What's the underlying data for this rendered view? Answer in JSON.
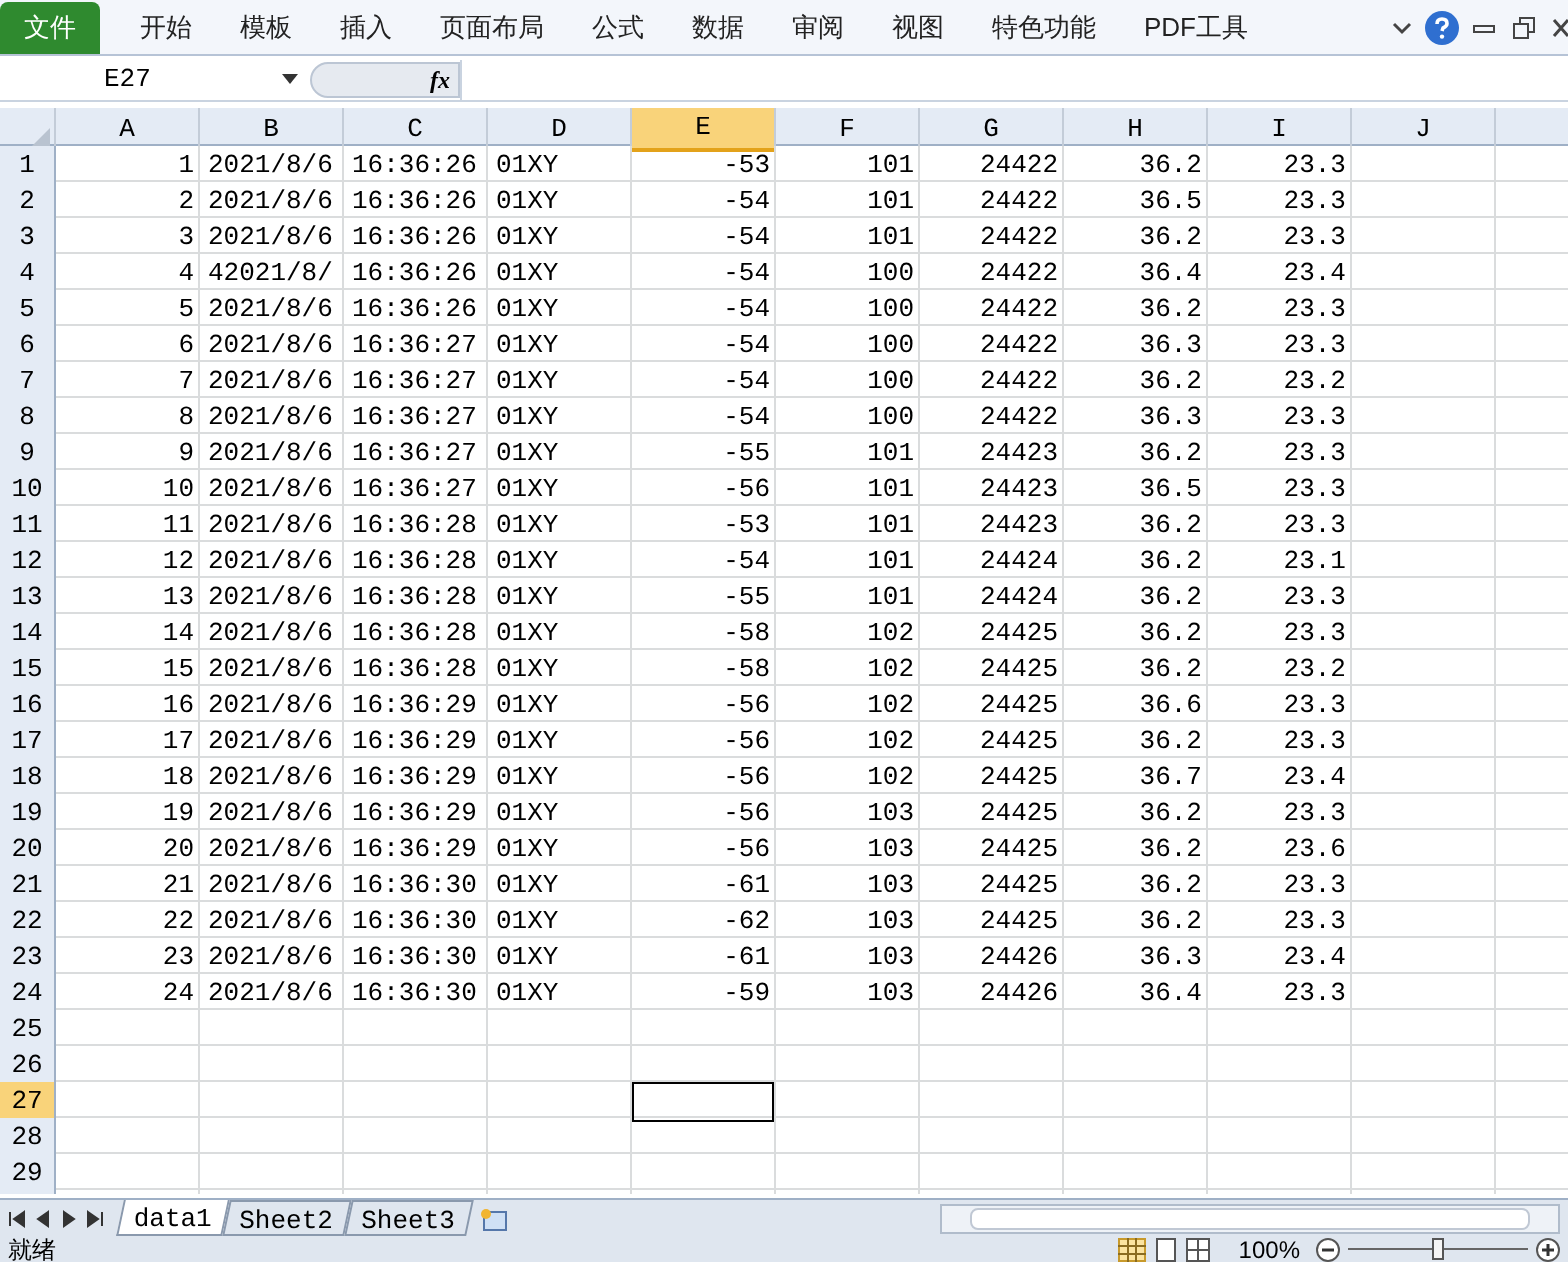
{
  "ribbon_tabs": [
    {
      "label": "文件",
      "kind": "file",
      "selected": false
    },
    {
      "label": "开始",
      "kind": "tab",
      "selected": false
    },
    {
      "label": "模板",
      "kind": "tab",
      "selected": false
    },
    {
      "label": "插入",
      "kind": "tab",
      "selected": false
    },
    {
      "label": "页面布局",
      "kind": "tab",
      "selected": false
    },
    {
      "label": "公式",
      "kind": "tab",
      "selected": false
    },
    {
      "label": "数据",
      "kind": "tab",
      "selected": false
    },
    {
      "label": "审阅",
      "kind": "tab",
      "selected": false
    },
    {
      "label": "视图",
      "kind": "tab",
      "selected": false
    },
    {
      "label": "特色功能",
      "kind": "tab",
      "selected": false
    },
    {
      "label": "PDF工具",
      "kind": "tab",
      "selected": false
    }
  ],
  "formula_bar": {
    "name_box": "E27",
    "fx": "fx"
  },
  "columns": [
    {
      "label": "A",
      "kind": "number",
      "selected": false
    },
    {
      "label": "B",
      "kind": "text",
      "selected": false
    },
    {
      "label": "C",
      "kind": "text",
      "selected": false
    },
    {
      "label": "D",
      "kind": "text",
      "selected": false
    },
    {
      "label": "E",
      "kind": "number",
      "selected": true
    },
    {
      "label": "F",
      "kind": "number",
      "selected": false
    },
    {
      "label": "G",
      "kind": "number",
      "selected": false
    },
    {
      "label": "H",
      "kind": "number",
      "selected": false
    },
    {
      "label": "I",
      "kind": "number",
      "selected": false
    },
    {
      "label": "J",
      "kind": "number",
      "selected": false
    }
  ],
  "rows": [
    {
      "header": "1",
      "selected": false,
      "cells": [
        "1",
        "2021/8/6",
        "16:36:26",
        "01XY",
        "-53",
        "101",
        "24422",
        "36.2",
        "23.3"
      ]
    },
    {
      "header": "2",
      "selected": false,
      "cells": [
        "2",
        "2021/8/6",
        "16:36:26",
        "01XY",
        "-54",
        "101",
        "24422",
        "36.5",
        "23.3"
      ]
    },
    {
      "header": "3",
      "selected": false,
      "cells": [
        "3",
        "2021/8/6",
        "16:36:26",
        "01XY",
        "-54",
        "101",
        "24422",
        "36.2",
        "23.3"
      ]
    },
    {
      "header": "4",
      "selected": false,
      "cells": [
        "4",
        "42021/8/",
        "16:36:26",
        "01XY",
        "-54",
        "100",
        "24422",
        "36.4",
        "23.4"
      ]
    },
    {
      "header": "5",
      "selected": false,
      "cells": [
        "5",
        "2021/8/6",
        "16:36:26",
        "01XY",
        "-54",
        "100",
        "24422",
        "36.2",
        "23.3"
      ]
    },
    {
      "header": "6",
      "selected": false,
      "cells": [
        "6",
        "2021/8/6",
        "16:36:27",
        "01XY",
        "-54",
        "100",
        "24422",
        "36.3",
        "23.3"
      ]
    },
    {
      "header": "7",
      "selected": false,
      "cells": [
        "7",
        "2021/8/6",
        "16:36:27",
        "01XY",
        "-54",
        "100",
        "24422",
        "36.2",
        "23.2"
      ]
    },
    {
      "header": "8",
      "selected": false,
      "cells": [
        "8",
        "2021/8/6",
        "16:36:27",
        "01XY",
        "-54",
        "100",
        "24422",
        "36.3",
        "23.3"
      ]
    },
    {
      "header": "9",
      "selected": false,
      "cells": [
        "9",
        "2021/8/6",
        "16:36:27",
        "01XY",
        "-55",
        "101",
        "24423",
        "36.2",
        "23.3"
      ]
    },
    {
      "header": "10",
      "selected": false,
      "cells": [
        "10",
        "2021/8/6",
        "16:36:27",
        "01XY",
        "-56",
        "101",
        "24423",
        "36.5",
        "23.3"
      ]
    },
    {
      "header": "11",
      "selected": false,
      "cells": [
        "11",
        "2021/8/6",
        "16:36:28",
        "01XY",
        "-53",
        "101",
        "24423",
        "36.2",
        "23.3"
      ]
    },
    {
      "header": "12",
      "selected": false,
      "cells": [
        "12",
        "2021/8/6",
        "16:36:28",
        "01XY",
        "-54",
        "101",
        "24424",
        "36.2",
        "23.1"
      ]
    },
    {
      "header": "13",
      "selected": false,
      "cells": [
        "13",
        "2021/8/6",
        "16:36:28",
        "01XY",
        "-55",
        "101",
        "24424",
        "36.2",
        "23.3"
      ]
    },
    {
      "header": "14",
      "selected": false,
      "cells": [
        "14",
        "2021/8/6",
        "16:36:28",
        "01XY",
        "-58",
        "102",
        "24425",
        "36.2",
        "23.3"
      ]
    },
    {
      "header": "15",
      "selected": false,
      "cells": [
        "15",
        "2021/8/6",
        "16:36:28",
        "01XY",
        "-58",
        "102",
        "24425",
        "36.2",
        "23.2"
      ]
    },
    {
      "header": "16",
      "selected": false,
      "cells": [
        "16",
        "2021/8/6",
        "16:36:29",
        "01XY",
        "-56",
        "102",
        "24425",
        "36.6",
        "23.3"
      ]
    },
    {
      "header": "17",
      "selected": false,
      "cells": [
        "17",
        "2021/8/6",
        "16:36:29",
        "01XY",
        "-56",
        "102",
        "24425",
        "36.2",
        "23.3"
      ]
    },
    {
      "header": "18",
      "selected": false,
      "cells": [
        "18",
        "2021/8/6",
        "16:36:29",
        "01XY",
        "-56",
        "102",
        "24425",
        "36.7",
        "23.4"
      ]
    },
    {
      "header": "19",
      "selected": false,
      "cells": [
        "19",
        "2021/8/6",
        "16:36:29",
        "01XY",
        "-56",
        "103",
        "24425",
        "36.2",
        "23.3"
      ]
    },
    {
      "header": "20",
      "selected": false,
      "cells": [
        "20",
        "2021/8/6",
        "16:36:29",
        "01XY",
        "-56",
        "103",
        "24425",
        "36.2",
        "23.6"
      ]
    },
    {
      "header": "21",
      "selected": false,
      "cells": [
        "21",
        "2021/8/6",
        "16:36:30",
        "01XY",
        "-61",
        "103",
        "24425",
        "36.2",
        "23.3"
      ]
    },
    {
      "header": "22",
      "selected": false,
      "cells": [
        "22",
        "2021/8/6",
        "16:36:30",
        "01XY",
        "-62",
        "103",
        "24425",
        "36.2",
        "23.3"
      ]
    },
    {
      "header": "23",
      "selected": false,
      "cells": [
        "23",
        "2021/8/6",
        "16:36:30",
        "01XY",
        "-61",
        "103",
        "24426",
        "36.3",
        "23.4"
      ]
    },
    {
      "header": "24",
      "selected": false,
      "cells": [
        "24",
        "2021/8/6",
        "16:36:30",
        "01XY",
        "-59",
        "103",
        "24426",
        "36.4",
        "23.3"
      ]
    },
    {
      "header": "25",
      "selected": false
    },
    {
      "header": "26",
      "selected": false
    },
    {
      "header": "27",
      "selected": true
    },
    {
      "header": "28",
      "selected": false
    },
    {
      "header": "29",
      "selected": false
    }
  ],
  "sheet_tabs": [
    {
      "label": "data1",
      "selected": true
    },
    {
      "label": "Sheet2",
      "selected": false
    },
    {
      "label": "Sheet3",
      "selected": false
    }
  ],
  "status_bar": {
    "status": "就绪",
    "zoom": "100%",
    "zoom_slider": {
      "level": 0.5
    }
  }
}
